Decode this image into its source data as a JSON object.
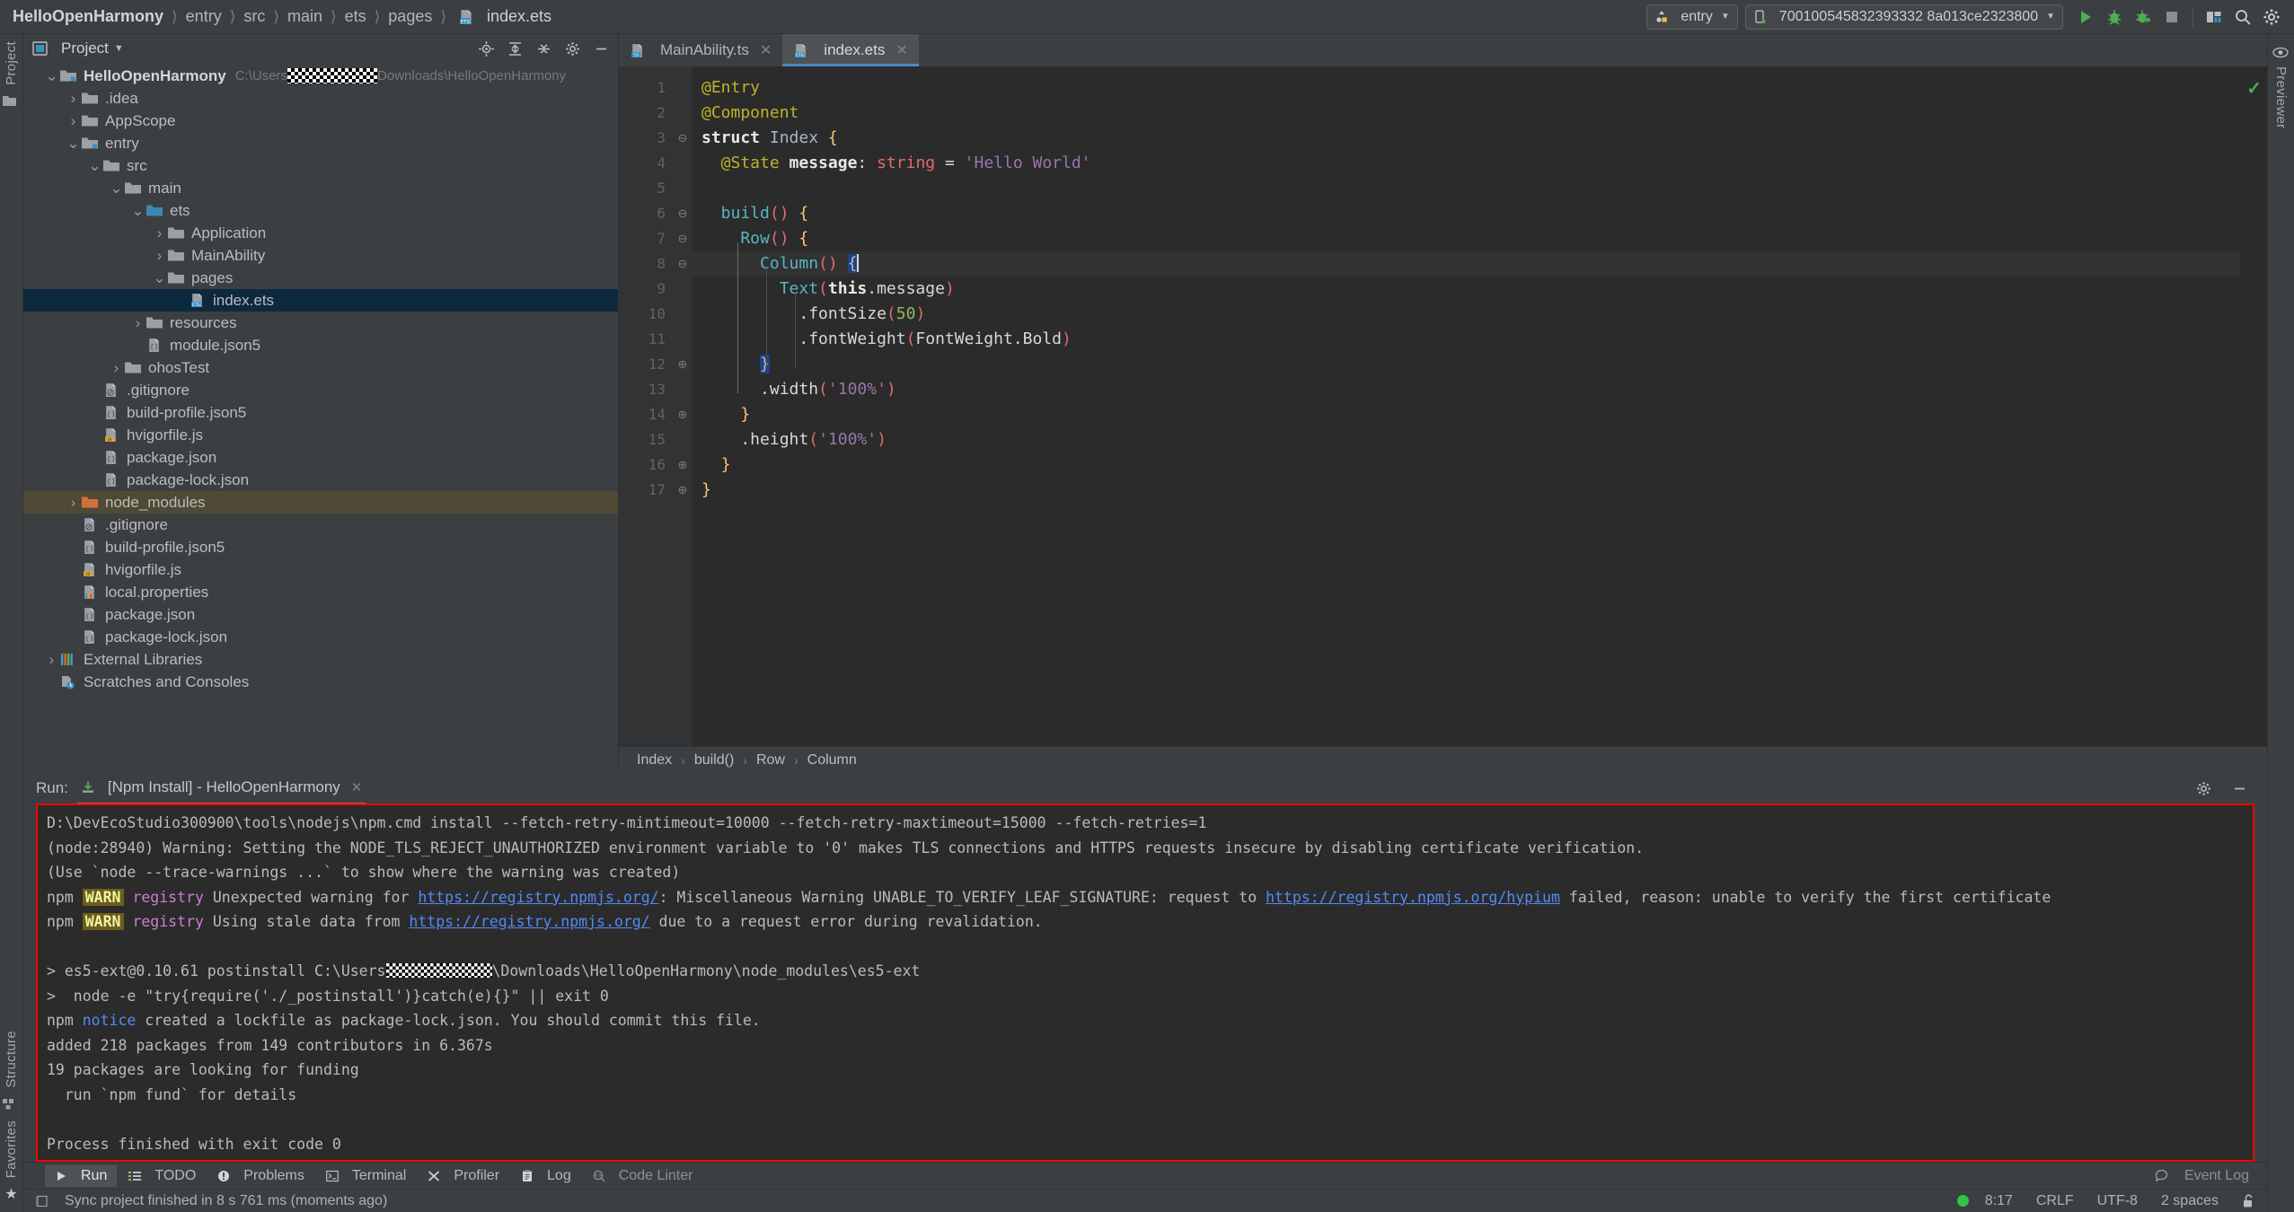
{
  "topbar": {
    "breadcrumb": [
      "HelloOpenHarmony",
      "entry",
      "src",
      "main",
      "ets",
      "pages"
    ],
    "file": "index.ets",
    "run_config": "entry",
    "device": "700100545832393332 8a013ce2323800",
    "icons": [
      "run-icon",
      "debug-icon",
      "profile-icon",
      "stop-icon",
      "device-manager-icon",
      "search-icon",
      "settings-icon"
    ]
  },
  "left_rail": {
    "project_label": "Project",
    "structure_label": "Structure",
    "favorites_label": "Favorites"
  },
  "right_rail": {
    "previewer_label": "Previewer"
  },
  "project_panel": {
    "title": "Project",
    "toolbar_icons": [
      "locate-icon",
      "expand-all-icon",
      "collapse-all-icon",
      "gear-icon",
      "minimize-icon"
    ],
    "tree": [
      {
        "indent": 0,
        "twisty": "v",
        "icon": "module-folder",
        "label": "HelloOpenHarmony",
        "bold": true,
        "path_prefix": "C:\\Users",
        "censored": true,
        "path_suffix": "Downloads\\HelloOpenHarmony",
        "state": "normal"
      },
      {
        "indent": 1,
        "twisty": ">",
        "icon": "folder",
        "label": ".idea",
        "state": "normal"
      },
      {
        "indent": 1,
        "twisty": ">",
        "icon": "folder",
        "label": "AppScope",
        "state": "normal"
      },
      {
        "indent": 1,
        "twisty": "v",
        "icon": "module-folder",
        "label": "entry",
        "state": "normal"
      },
      {
        "indent": 2,
        "twisty": "v",
        "icon": "folder",
        "label": "src",
        "state": "normal"
      },
      {
        "indent": 3,
        "twisty": "v",
        "icon": "folder",
        "label": "main",
        "state": "normal"
      },
      {
        "indent": 4,
        "twisty": "v",
        "icon": "folder-blue",
        "label": "ets",
        "state": "normal"
      },
      {
        "indent": 5,
        "twisty": ">",
        "icon": "folder",
        "label": "Application",
        "state": "normal"
      },
      {
        "indent": 5,
        "twisty": ">",
        "icon": "folder",
        "label": "MainAbility",
        "state": "normal"
      },
      {
        "indent": 5,
        "twisty": "v",
        "icon": "folder",
        "label": "pages",
        "state": "normal"
      },
      {
        "indent": 6,
        "twisty": "",
        "icon": "ets-file",
        "label": "index.ets",
        "state": "selected"
      },
      {
        "indent": 4,
        "twisty": ">",
        "icon": "folder",
        "label": "resources",
        "state": "normal"
      },
      {
        "indent": 4,
        "twisty": "",
        "icon": "json-file",
        "label": "module.json5",
        "state": "normal"
      },
      {
        "indent": 3,
        "twisty": ">",
        "icon": "folder",
        "label": "ohosTest",
        "state": "normal"
      },
      {
        "indent": 2,
        "twisty": "",
        "icon": "gitignore-file",
        "label": ".gitignore",
        "state": "normal"
      },
      {
        "indent": 2,
        "twisty": "",
        "icon": "json-file",
        "label": "build-profile.json5",
        "state": "normal"
      },
      {
        "indent": 2,
        "twisty": "",
        "icon": "js-file",
        "label": "hvigorfile.js",
        "state": "normal"
      },
      {
        "indent": 2,
        "twisty": "",
        "icon": "json-file",
        "label": "package.json",
        "state": "normal"
      },
      {
        "indent": 2,
        "twisty": "",
        "icon": "json-file",
        "label": "package-lock.json",
        "state": "normal"
      },
      {
        "indent": 1,
        "twisty": ">",
        "icon": "folder-orange",
        "label": "node_modules",
        "state": "highlight"
      },
      {
        "indent": 1,
        "twisty": "",
        "icon": "gitignore-file",
        "label": ".gitignore",
        "state": "normal"
      },
      {
        "indent": 1,
        "twisty": "",
        "icon": "json-file",
        "label": "build-profile.json5",
        "state": "normal"
      },
      {
        "indent": 1,
        "twisty": "",
        "icon": "js-file",
        "label": "hvigorfile.js",
        "state": "normal"
      },
      {
        "indent": 1,
        "twisty": "",
        "icon": "properties-file",
        "label": "local.properties",
        "state": "normal"
      },
      {
        "indent": 1,
        "twisty": "",
        "icon": "json-file",
        "label": "package.json",
        "state": "normal"
      },
      {
        "indent": 1,
        "twisty": "",
        "icon": "json-file",
        "label": "package-lock.json",
        "state": "normal"
      },
      {
        "indent": 0,
        "twisty": ">",
        "icon": "libraries-icon",
        "label": "External Libraries",
        "state": "normal"
      },
      {
        "indent": 0,
        "twisty": "",
        "icon": "scratches-icon",
        "label": "Scratches and Consoles",
        "state": "normal"
      }
    ]
  },
  "editor": {
    "tabs": [
      {
        "label": "MainAbility.ts",
        "icon": "ts-file",
        "active": false
      },
      {
        "label": "index.ets",
        "icon": "ets-file",
        "active": true
      }
    ],
    "line_numbers": [
      "1",
      "2",
      "3",
      "4",
      "5",
      "6",
      "7",
      "8",
      "9",
      "10",
      "11",
      "12",
      "13",
      "14",
      "15",
      "16",
      "17"
    ],
    "lines": [
      [
        {
          "t": "@Entry",
          "c": "tok-ann"
        }
      ],
      [
        {
          "t": "@Component",
          "c": "tok-ann"
        }
      ],
      [
        {
          "t": "struct ",
          "c": "tok-kw"
        },
        {
          "t": "Index ",
          "c": "tok-type"
        },
        {
          "t": "{",
          "c": "tok-br"
        }
      ],
      [
        {
          "t": "  @State ",
          "c": "tok-ann"
        },
        {
          "t": "message",
          "c": "tok-kw"
        },
        {
          "t": ": ",
          "c": "tok-op"
        },
        {
          "t": "string",
          "c": "tok-paren"
        },
        {
          "t": " = ",
          "c": "tok-op"
        },
        {
          "t": "'Hello World'",
          "c": "tok-str"
        }
      ],
      [],
      [
        {
          "t": "  build",
          "c": "tok-fn"
        },
        {
          "t": "()",
          "c": "tok-paren"
        },
        {
          "t": " ",
          "c": "tok-op"
        },
        {
          "t": "{",
          "c": "tok-br"
        }
      ],
      [
        {
          "t": "    Row",
          "c": "tok-fn"
        },
        {
          "t": "()",
          "c": "tok-paren"
        },
        {
          "t": " ",
          "c": "tok-op"
        },
        {
          "t": "{",
          "c": "tok-br"
        }
      ],
      [
        {
          "t": "      Column",
          "c": "tok-fn"
        },
        {
          "t": "()",
          "c": "tok-paren"
        },
        {
          "t": " ",
          "c": "tok-op"
        },
        {
          "t": "{",
          "c": "sel-br"
        }
      ],
      [
        {
          "t": "        Text",
          "c": "tok-fn"
        },
        {
          "t": "(",
          "c": "tok-paren"
        },
        {
          "t": "this",
          "c": "tok-this"
        },
        {
          "t": ".message",
          "c": "tok-plain"
        },
        {
          "t": ")",
          "c": "tok-paren"
        }
      ],
      [
        {
          "t": "          .fontSize",
          "c": "tok-plain"
        },
        {
          "t": "(",
          "c": "tok-paren"
        },
        {
          "t": "50",
          "c": "tok-num"
        },
        {
          "t": ")",
          "c": "tok-paren"
        }
      ],
      [
        {
          "t": "          .fontWeight",
          "c": "tok-plain"
        },
        {
          "t": "(",
          "c": "tok-paren"
        },
        {
          "t": "FontWeight.Bold",
          "c": "tok-plain"
        },
        {
          "t": ")",
          "c": "tok-paren"
        }
      ],
      [
        {
          "t": "      ",
          "c": "tok-op"
        },
        {
          "t": "}",
          "c": "sel-br"
        }
      ],
      [
        {
          "t": "      .width",
          "c": "tok-plain"
        },
        {
          "t": "(",
          "c": "tok-paren"
        },
        {
          "t": "'100%'",
          "c": "tok-str"
        },
        {
          "t": ")",
          "c": "tok-paren"
        }
      ],
      [
        {
          "t": "    ",
          "c": "tok-op"
        },
        {
          "t": "}",
          "c": "tok-br"
        }
      ],
      [
        {
          "t": "    .height",
          "c": "tok-plain"
        },
        {
          "t": "(",
          "c": "tok-paren"
        },
        {
          "t": "'100%'",
          "c": "tok-str"
        },
        {
          "t": ")",
          "c": "tok-paren"
        }
      ],
      [
        {
          "t": "  ",
          "c": "tok-op"
        },
        {
          "t": "}",
          "c": "tok-br"
        }
      ],
      [
        {
          "t": "}",
          "c": "tok-br"
        }
      ]
    ],
    "breadcrumb": [
      "Index",
      "build()",
      "Row",
      "Column"
    ],
    "inspection_ok": true
  },
  "run_panel": {
    "label": "Run:",
    "tab_title": "[Npm Install] - HelloOpenHarmony",
    "toolbar_icons": [
      "gear-icon",
      "minimize-icon"
    ],
    "console_lines": [
      [
        {
          "t": "D:\\DevEcoStudio300900\\tools\\nodejs\\npm.cmd install --fetch-retry-mintimeout=10000 --fetch-retry-maxtimeout=15000 --fetch-retries=1",
          "c": ""
        }
      ],
      [
        {
          "t": "(node:28940) Warning: Setting the NODE_TLS_REJECT_UNAUTHORIZED environment variable to '0' makes TLS connections and HTTPS requests insecure by disabling certificate verification.",
          "c": ""
        }
      ],
      [
        {
          "t": "(Use `node --trace-warnings ...` to show where the warning was created)",
          "c": ""
        }
      ],
      [
        {
          "t": "npm ",
          "c": ""
        },
        {
          "t": "WARN",
          "c": "c-warn"
        },
        {
          "t": " ",
          "c": ""
        },
        {
          "t": "registry",
          "c": "c-reg"
        },
        {
          "t": " Unexpected warning for ",
          "c": ""
        },
        {
          "t": "https://registry.npmjs.org/",
          "c": "c-link"
        },
        {
          "t": ": Miscellaneous Warning UNABLE_TO_VERIFY_LEAF_SIGNATURE: request to ",
          "c": ""
        },
        {
          "t": "https://registry.npmjs.org/hypium",
          "c": "c-link"
        },
        {
          "t": " failed, reason: unable to verify the first certificate",
          "c": ""
        }
      ],
      [
        {
          "t": "npm ",
          "c": ""
        },
        {
          "t": "WARN",
          "c": "c-warn"
        },
        {
          "t": " ",
          "c": ""
        },
        {
          "t": "registry",
          "c": "c-reg"
        },
        {
          "t": " Using stale data from ",
          "c": ""
        },
        {
          "t": "https://registry.npmjs.org/",
          "c": "c-link"
        },
        {
          "t": " due to a request error during revalidation.",
          "c": ""
        }
      ],
      [],
      [
        {
          "t": "> es5-ext@0.10.61 postinstall C:\\Users",
          "c": ""
        },
        {
          "t": "",
          "c": "c-censor"
        },
        {
          "t": "\\Downloads\\HelloOpenHarmony\\node_modules\\es5-ext",
          "c": ""
        }
      ],
      [
        {
          "t": ">  node -e \"try{require('./_postinstall')}catch(e){}\" || exit 0",
          "c": ""
        }
      ],
      [
        {
          "t": "npm ",
          "c": ""
        },
        {
          "t": "notice",
          "c": "c-notice"
        },
        {
          "t": " created a lockfile as package-lock.json. You should commit this file.",
          "c": ""
        }
      ],
      [
        {
          "t": "added 218 packages from 149 contributors in 6.367s",
          "c": ""
        }
      ],
      [
        {
          "t": "19 packages are looking for funding",
          "c": ""
        }
      ],
      [
        {
          "t": "  run `npm fund` for details",
          "c": ""
        }
      ],
      [],
      [
        {
          "t": "Process finished with exit code 0",
          "c": ""
        }
      ]
    ]
  },
  "bottom_tools": [
    {
      "label": "Run",
      "icon": "run-icon",
      "active": true
    },
    {
      "label": "TODO",
      "icon": "todo-icon",
      "active": false
    },
    {
      "label": "Problems",
      "icon": "problems-icon",
      "active": false
    },
    {
      "label": "Terminal",
      "icon": "terminal-icon",
      "active": false
    },
    {
      "label": "Profiler",
      "icon": "profiler-icon",
      "active": false
    },
    {
      "label": "Log",
      "icon": "log-icon",
      "active": false
    },
    {
      "label": "Code Linter",
      "icon": "linter-icon",
      "active": false,
      "dim": true
    }
  ],
  "event_log": "Event Log",
  "status_bar": {
    "message": "Sync project finished in 8 s 761 ms (moments ago)",
    "caret": "8:17",
    "line_sep": "CRLF",
    "encoding": "UTF-8",
    "indent": "2 spaces",
    "lock_icon": "unlocked-icon"
  }
}
